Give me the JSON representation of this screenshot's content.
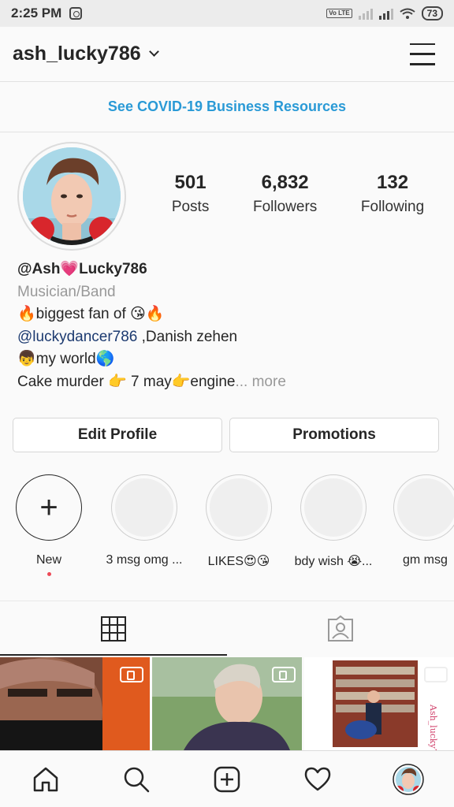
{
  "status_bar": {
    "time": "2:25 PM",
    "network_badge": "Vo LTE",
    "battery": "73",
    "icons": [
      "instagram-icon",
      "signal-icon",
      "wifi-icon",
      "battery-icon"
    ]
  },
  "header": {
    "username": "ash_lucky786",
    "icons": [
      "chevron-down-icon",
      "hamburger-menu-icon"
    ]
  },
  "banner": {
    "text": "See COVID-19 Business Resources",
    "color": "#2a9ad6"
  },
  "profile": {
    "stats": [
      {
        "value": "501",
        "label": "Posts"
      },
      {
        "value": "6,832",
        "label": "Followers"
      },
      {
        "value": "132",
        "label": "Following"
      }
    ],
    "bio": {
      "name": "@Ash💗Lucky786",
      "category": "Musician/Band",
      "line1": "🔥biggest fan of 😘🔥",
      "mention": "@luckydancer786",
      "line2_rest": " ,Danish zehen",
      "line3": "👦my world🌎",
      "line4": "Cake murder 👉 7 may👉engine",
      "more": "... more"
    }
  },
  "buttons": {
    "edit_profile": "Edit Profile",
    "promotions": "Promotions"
  },
  "highlights": [
    {
      "label": "New"
    },
    {
      "label": "3 msg omg ..."
    },
    {
      "label": "LIKES😍😘"
    },
    {
      "label": "bdy wish 😭..."
    },
    {
      "label": "gm msg"
    }
  ],
  "tabs": [
    "grid-icon",
    "tagged-icon"
  ],
  "bottom_nav": [
    "home-icon",
    "search-icon",
    "new-post-icon",
    "heart-icon",
    "profile-avatar"
  ],
  "colors": {
    "accent": "#2a9ad6",
    "notification_dot": "#ed4956",
    "text": "#262626",
    "muted": "#999999"
  }
}
